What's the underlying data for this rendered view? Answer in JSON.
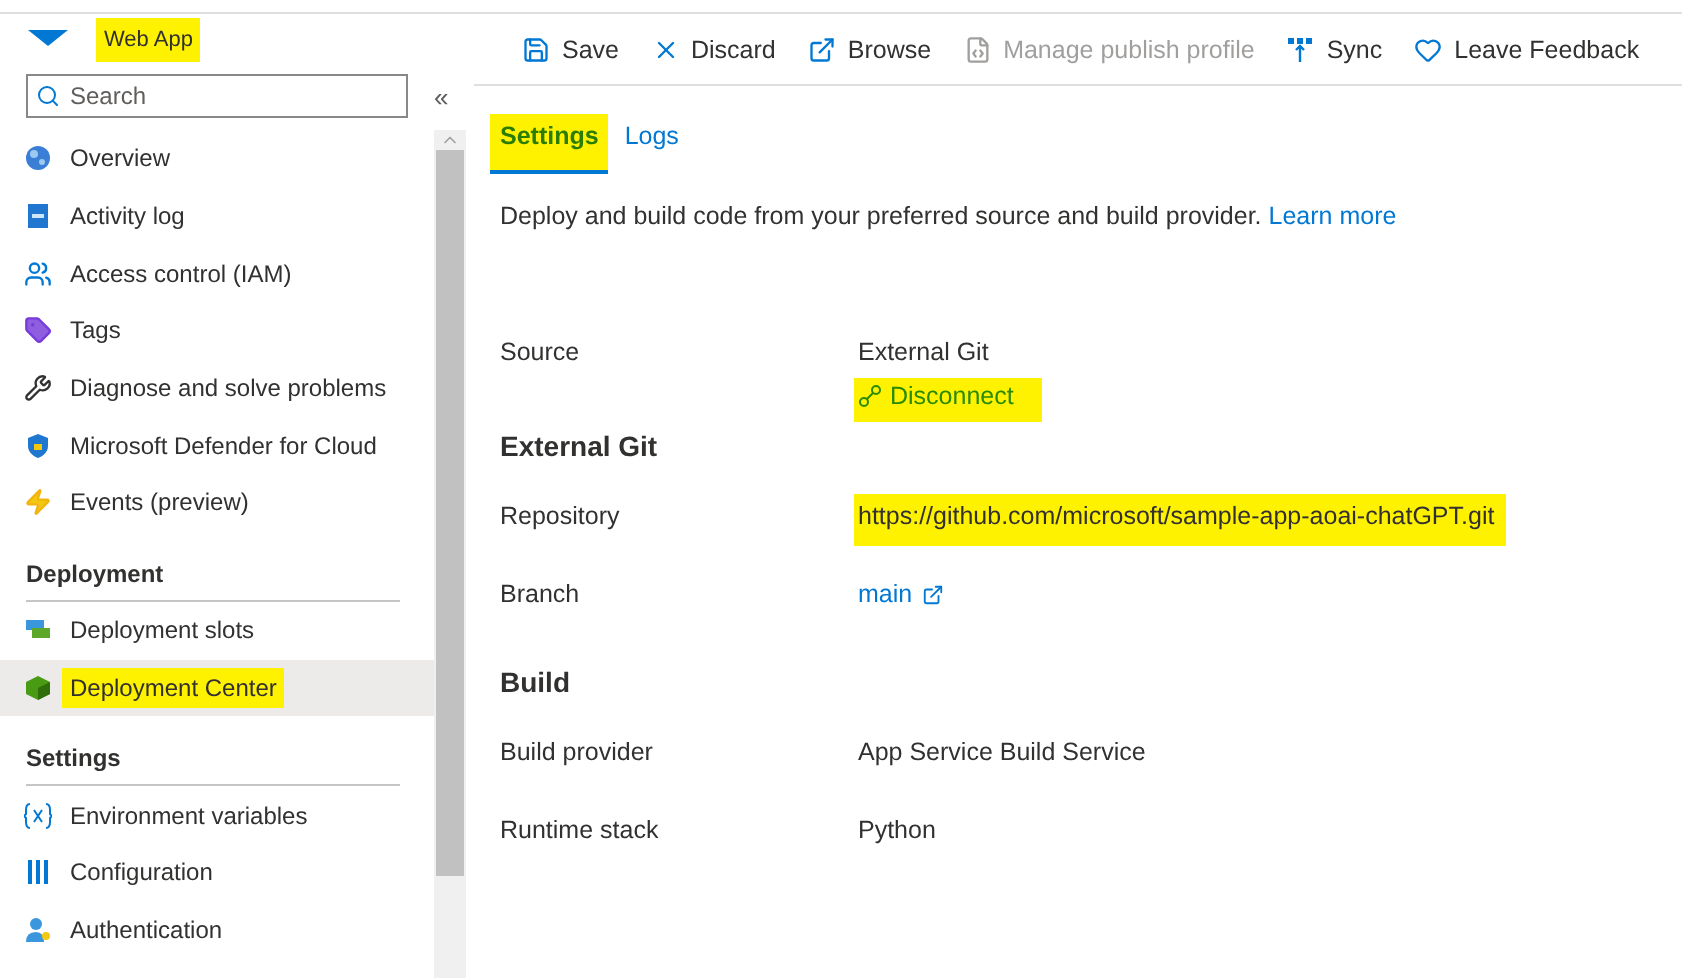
{
  "header": {
    "title": "Web App",
    "highlighted": true
  },
  "search": {
    "placeholder": "Search"
  },
  "collapse_button": "«",
  "sidebar": {
    "items": [
      {
        "kind": "item",
        "label": "Overview",
        "selected": false,
        "highlighted": false
      },
      {
        "kind": "item",
        "label": "Activity log",
        "selected": false,
        "highlighted": false
      },
      {
        "kind": "item",
        "label": "Access control (IAM)",
        "selected": false,
        "highlighted": false
      },
      {
        "kind": "item",
        "label": "Tags",
        "selected": false,
        "highlighted": false
      },
      {
        "kind": "item",
        "label": "Diagnose and solve problems",
        "selected": false,
        "highlighted": false
      },
      {
        "kind": "item",
        "label": "Microsoft Defender for Cloud",
        "selected": false,
        "highlighted": false
      },
      {
        "kind": "item",
        "label": "Events (preview)",
        "selected": false,
        "highlighted": false
      },
      {
        "kind": "heading",
        "label": "Deployment"
      },
      {
        "kind": "item",
        "label": "Deployment slots",
        "selected": false,
        "highlighted": false
      },
      {
        "kind": "item",
        "label": "Deployment Center",
        "selected": true,
        "highlighted": true
      },
      {
        "kind": "heading",
        "label": "Settings"
      },
      {
        "kind": "item",
        "label": "Environment variables",
        "selected": false,
        "highlighted": false
      },
      {
        "kind": "item",
        "label": "Configuration",
        "selected": false,
        "highlighted": false
      },
      {
        "kind": "item",
        "label": "Authentication",
        "selected": false,
        "highlighted": false
      }
    ]
  },
  "toolbar": [
    {
      "label": "Save",
      "disabled": false
    },
    {
      "label": "Discard",
      "disabled": false
    },
    {
      "label": "Browse",
      "disabled": false
    },
    {
      "label": "Manage publish profile",
      "disabled": true
    },
    {
      "label": "Sync",
      "disabled": false
    },
    {
      "label": "Leave Feedback",
      "disabled": false
    }
  ],
  "tabs": [
    {
      "label": "Settings",
      "selected": true,
      "highlighted": true
    },
    {
      "label": "Logs",
      "selected": false,
      "highlighted": false
    }
  ],
  "description": {
    "text": "Deploy and build code from your preferred source and build provider.",
    "link": "Learn more"
  },
  "fields": [
    {
      "kind": "field",
      "label": "Source",
      "value": "External Git",
      "action": {
        "label": "Disconnect",
        "highlighted": true
      }
    },
    {
      "kind": "heading",
      "label": "External Git"
    },
    {
      "kind": "field",
      "label": "Repository",
      "value": "https://github.com/microsoft/sample-app-aoai-chatGPT.git",
      "highlighted": true
    },
    {
      "kind": "link",
      "label": "Branch",
      "value": "main"
    },
    {
      "kind": "heading",
      "label": "Build"
    },
    {
      "kind": "field",
      "label": "Build provider",
      "value": "App Service Build Service"
    },
    {
      "kind": "field",
      "label": "Runtime stack",
      "value": "Python"
    }
  ]
}
